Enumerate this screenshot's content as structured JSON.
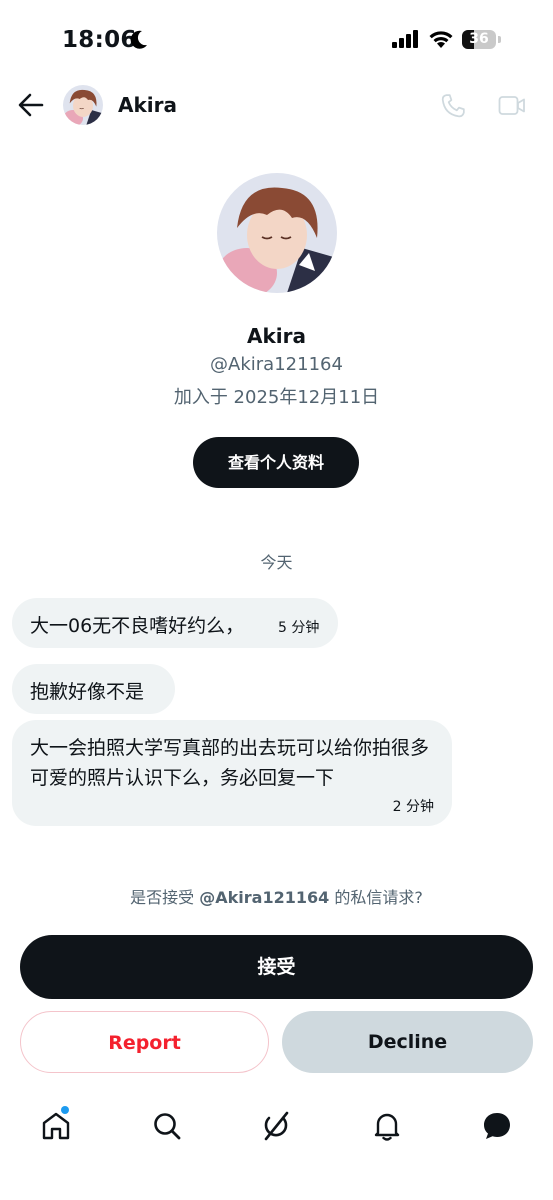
{
  "status_bar": {
    "time": "18:06",
    "battery": "36"
  },
  "header": {
    "name": "Akira"
  },
  "profile": {
    "name": "Akira",
    "handle": "@Akira121164",
    "joined": "加入于 2025年12月11日",
    "view_profile_label": "查看个人资料"
  },
  "conversation": {
    "date_separator": "今天",
    "messages": [
      {
        "text": "大一06无不良嗜好约么，",
        "time": "5 分钟"
      },
      {
        "text": "抱歉好像不是",
        "time": ""
      },
      {
        "text": "大一会拍照大学写真部的出去玩可以给你拍很多可爱的照片认识下么，务必回复一下",
        "time": "2 分钟"
      }
    ]
  },
  "request": {
    "prefix": "是否接受 ",
    "handle": "@Akira121164",
    "suffix": " 的私信请求?"
  },
  "actions": {
    "accept": "接受",
    "report": "Report",
    "decline": "Decline"
  },
  "colors": {
    "accent": "#1d9bf0",
    "danger": "#f4212e",
    "dark": "#0f1419",
    "bubble": "#eff3f4"
  },
  "tab_bar": {
    "items": [
      "home-icon",
      "search-icon",
      "grok-icon",
      "notifications-icon",
      "messages-icon"
    ]
  }
}
